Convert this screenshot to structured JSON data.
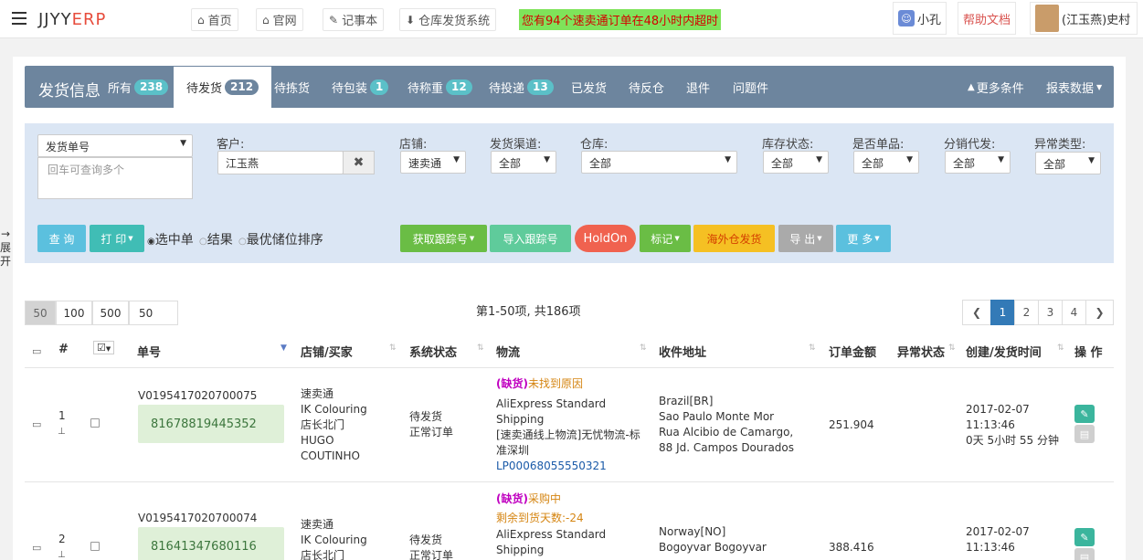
{
  "topnav": {
    "brand_main": "JJYY",
    "brand_accent": "ERP",
    "links": [
      "首页",
      "官网",
      "记事本",
      "仓库发货系统"
    ],
    "alert_pre": "您有",
    "alert_num": "94",
    "alert_mid": "个速卖通订单在",
    "alert_hours": "48",
    "alert_post": "小时内超时",
    "qq_user": "小孔",
    "help": "帮助文档",
    "user_name": "(江玉燕)史村"
  },
  "tabs": {
    "title": "发货信息",
    "items": [
      {
        "label": "所有",
        "badge": "238"
      },
      {
        "label": "待发货",
        "badge": "212"
      },
      {
        "label": "待拣货",
        "badge": ""
      },
      {
        "label": "待包装",
        "badge": "1"
      },
      {
        "label": "待称重",
        "badge": "12"
      },
      {
        "label": "待投递",
        "badge": "13"
      },
      {
        "label": "已发货",
        "badge": ""
      },
      {
        "label": "待反仓",
        "badge": ""
      },
      {
        "label": "退件",
        "badge": ""
      },
      {
        "label": "问题件",
        "badge": ""
      }
    ],
    "more": "更多条件",
    "report": "报表数据"
  },
  "filters": {
    "search_type": "发货单号",
    "search_placeholder": "回车可查询多个",
    "customer_label": "客户:",
    "customer_value": "江玉燕",
    "store_label": "店铺:",
    "store_value": "速卖通",
    "channel_label": "发货渠道:",
    "channel_value": "全部",
    "warehouse_label": "仓库:",
    "warehouse_value": "全部",
    "stock_label": "库存状态:",
    "stock_value": "全部",
    "single_label": "是否单品:",
    "single_value": "全部",
    "dist_label": "分销代发:",
    "dist_value": "全部",
    "abnormal_label": "异常类型:",
    "abnormal_value": "全部"
  },
  "actions": {
    "query": "查 询",
    "print": "打 印",
    "radio_selected": "选中单",
    "radio_result": "结果",
    "radio_sort": "最优储位排序",
    "track": "获取跟踪号",
    "import_track": "导入跟踪号",
    "holdon": "HoldOn",
    "mark": "标记",
    "overseas": "海外仓发货",
    "export": "导 出",
    "more": "更 多"
  },
  "paging": {
    "sizes": [
      "50",
      "100",
      "500"
    ],
    "size_input": "50",
    "info": "第1-50项, 共186项",
    "pages": [
      "1",
      "2",
      "3",
      "4"
    ]
  },
  "table": {
    "headers": [
      "#",
      "单号",
      "店铺/买家",
      "系统状态",
      "物流",
      "收件地址",
      "订单金额",
      "异常状态",
      "创建/发货时间",
      "操 作"
    ],
    "rows": [
      {
        "index": "1",
        "order_no": "V0195417020700075",
        "tracking": "81678819445352",
        "store": [
          "速卖通",
          "IK Colouring",
          "店长北门",
          "HUGO",
          "COUTINHO"
        ],
        "status": [
          "待发货",
          "正常订单"
        ],
        "log_tag": "(缺货)",
        "log_note": "未找到原因",
        "log_note2": "",
        "logistics": [
          "AliExpress Standard",
          "Shipping",
          "[速卖通线上物流]无忧物流-标",
          "准深圳"
        ],
        "log_code": "LP00068055550321",
        "address": [
          "Brazil[BR]",
          "Sao Paulo    Monte Mor",
          "Rua Alcibio de Camargo,",
          "88 Jd. Campos Dourados"
        ],
        "amount": "251.904",
        "time": [
          "2017-02-07",
          "11:13:46",
          "0天 5小时 55 分钟"
        ]
      },
      {
        "index": "2",
        "order_no": "V0195417020700074",
        "tracking": "81641347680116",
        "store": [
          "速卖通",
          "IK Colouring",
          "店长北门"
        ],
        "status": [
          "待发货",
          "正常订单"
        ],
        "log_tag": "(缺货)",
        "log_note": "采购中",
        "log_note2": "剩余到货天数:-24",
        "logistics": [
          "AliExpress Standard",
          "Shipping"
        ],
        "log_code": "",
        "address": [
          "Norway[NO]",
          "Bogoyvar    Bogoyvar"
        ],
        "amount": "388.416",
        "time": [
          "2017-02-07",
          "11:13:46"
        ]
      }
    ]
  },
  "side": {
    "expand": "展开"
  }
}
